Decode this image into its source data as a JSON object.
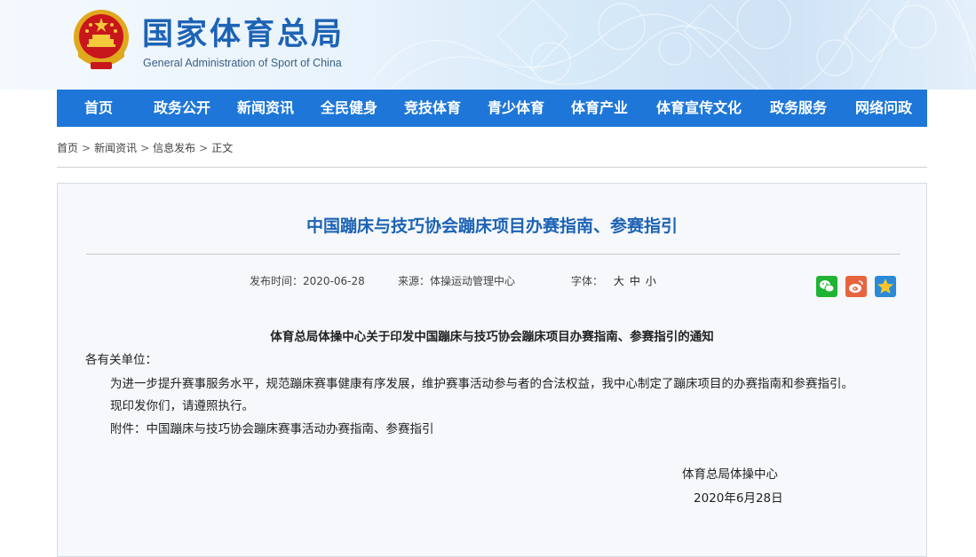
{
  "header": {
    "site_title": "国家体育总局",
    "site_subtitle": "General Administration of Sport of China",
    "emblem_icon": "national-emblem-icon"
  },
  "nav": {
    "items": [
      {
        "label": "首页"
      },
      {
        "label": "政务公开"
      },
      {
        "label": "新闻资讯"
      },
      {
        "label": "全民健身"
      },
      {
        "label": "竞技体育"
      },
      {
        "label": "青少体育"
      },
      {
        "label": "体育产业"
      },
      {
        "label": "体育宣传文化"
      },
      {
        "label": "政务服务"
      },
      {
        "label": "网络问政"
      }
    ],
    "background": "#1e77d8"
  },
  "breadcrumb": {
    "items": [
      "首页",
      "新闻资讯",
      "信息发布",
      "正文"
    ],
    "separator": ">"
  },
  "article": {
    "title": "中国蹦床与技巧协会蹦床项目办赛指南、参赛指引",
    "publish_time": "发布时间：2020-06-28",
    "source": "来源：体操运动管理中心",
    "font_label": "字体：",
    "font_sizes": [
      "大",
      "中",
      "小"
    ],
    "share_icons": [
      "wechat-icon",
      "weibo-icon",
      "qzone-icon"
    ],
    "notice_title": "体育总局体操中心关于印发中国蹦床与技巧协会蹦床项目办赛指南、参赛指引的通知",
    "salutation": "各有关单位：",
    "paragraph1": "为进一步提升赛事服务水平，规范蹦床赛事健康有序发展，维护赛事活动参与者的合法权益，我中心制定了蹦床项目的办赛指南和参赛指引。",
    "paragraph2": "现印发你们，请遵照执行。",
    "attachment": "附件：中国蹦床与技巧协会蹦床赛事活动办赛指南、参赛指引",
    "signature_org": "体育总局体操中心",
    "signature_date": "2020年6月28日",
    "title_color": "#1d63b5"
  }
}
